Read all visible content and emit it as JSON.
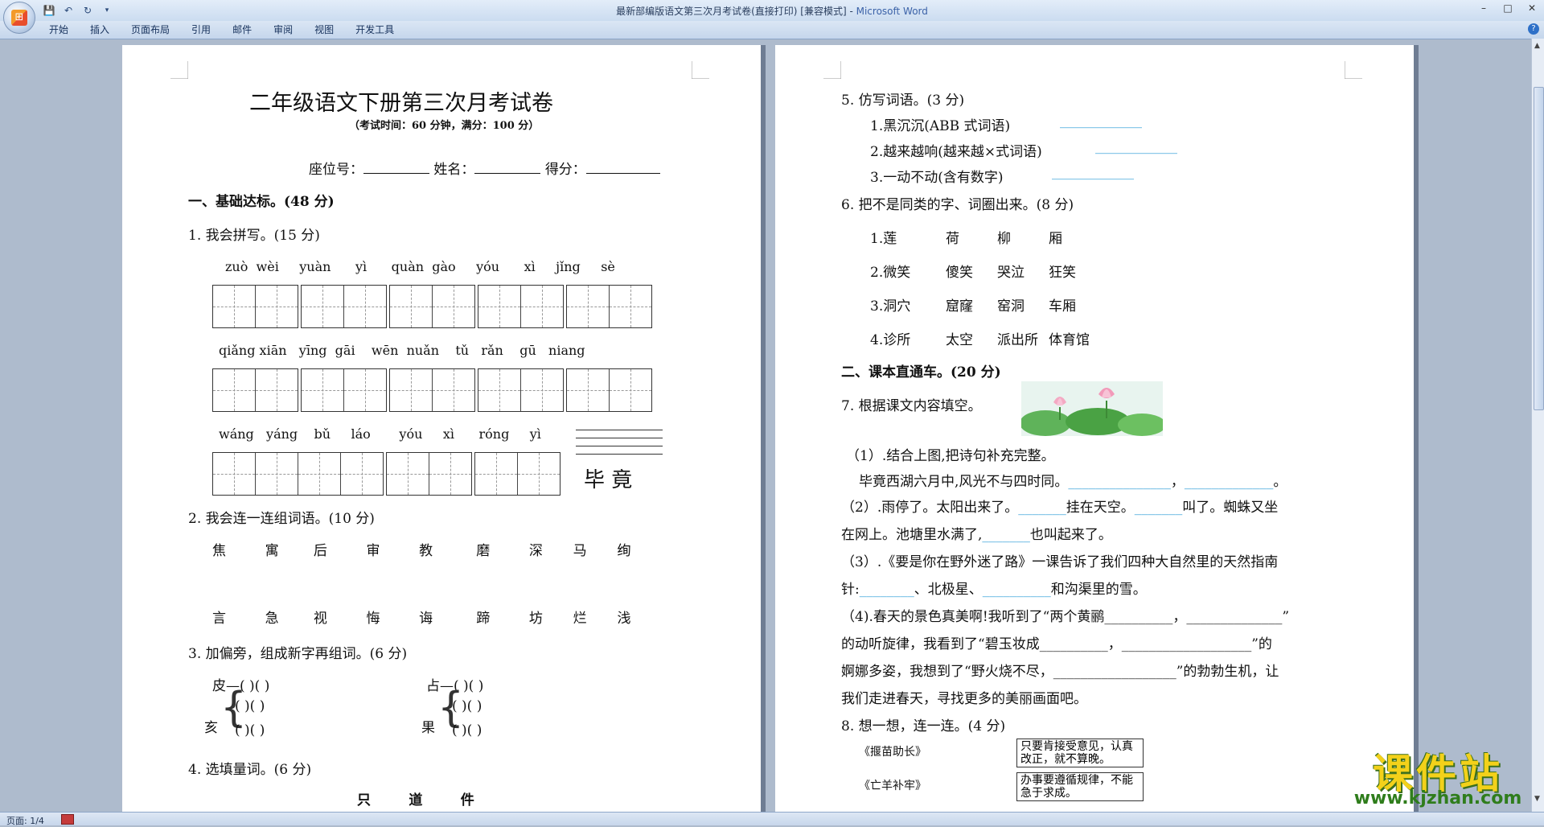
{
  "titlebar": {
    "doc_title": "最新部编版语文第三次月考试卷(直接打印) [兼容模式] - ",
    "app_name": "Microsoft Word"
  },
  "qat": {
    "save": "💾",
    "undo": "↶",
    "redo": "↻",
    "more": "▾"
  },
  "window_controls": {
    "minimize": "–",
    "maximize": "□",
    "close": "✕"
  },
  "ribbon": {
    "tabs": [
      "开始",
      "插入",
      "页面布局",
      "引用",
      "邮件",
      "审阅",
      "视图",
      "开发工具"
    ],
    "help": "?"
  },
  "statusbar": {
    "page": "页面: 1/4"
  },
  "watermark": {
    "title": "课件站",
    "url": "www.kjzhan.com"
  },
  "page1": {
    "title": "二年级语文下册第三次月考试卷",
    "subtitle": "（考试时间：60 分钟，满分：100 分）",
    "seat_label": "座位号：",
    "name_label": "姓名：",
    "score_label": "得分：",
    "section1": "一、基础达标。(48 分)",
    "q1": "1. 我会拼写。(15 分)",
    "pinyin_row1": [
      "zuò",
      "wèi",
      "yuàn",
      "yì",
      "quàn",
      "gào",
      "yóu",
      "xì",
      "jǐng",
      "sè"
    ],
    "pinyin_row2": [
      "qiǎng",
      "xiān",
      "yīng",
      "gāi",
      "wēn",
      "nuǎn",
      "tǔ",
      "rǎn",
      "gū",
      "niang"
    ],
    "pinyin_row3": [
      "wáng",
      "yáng",
      "bǔ",
      "láo",
      "yóu",
      "xì",
      "róng",
      "yì"
    ],
    "bijing": "毕  竟",
    "q2": "2. 我会连一连组词语。(10 分)",
    "match_row1": [
      "焦",
      "寓",
      "后",
      "审",
      "教",
      "磨",
      "深",
      "马",
      "绚"
    ],
    "match_row2": [
      "言",
      "急",
      "视",
      "悔",
      "诲",
      "蹄",
      "坊",
      "烂",
      "浅"
    ],
    "q3": "3. 加偏旁，组成新字再组词。(6 分)",
    "q3_a": "皮—(      )(        )",
    "q3_b": "占—(      )(        )",
    "q3_c_char": "亥",
    "q3_d_char": "果",
    "q3_paren": "(      )(      )",
    "q4": "4. 选填量词。(6 分)",
    "q4_words": [
      "只",
      "道",
      "件"
    ]
  },
  "page2": {
    "q5": "5. 仿写词语。(3 分)",
    "q5_1": "1.黑沉沉(ABB 式词语)",
    "q5_2": "2.越来越响(越来越×式词语)",
    "q5_3": "3.一动不动(含有数字)",
    "q6": "6. 把不是同类的字、词圈出来。(8 分)",
    "q6_rows": [
      [
        "1.莲",
        "荷",
        "柳",
        "厢"
      ],
      [
        "2.微笑",
        "傻笑",
        "哭泣",
        "狂笑"
      ],
      [
        "3.洞穴",
        "窟窿",
        "窑洞",
        "车厢"
      ],
      [
        "4.诊所",
        "太空",
        "派出所",
        "体育馆"
      ]
    ],
    "section2": "二、课本直通车。(20 分)",
    "q7": "7. 根据课文内容填空。",
    "q7_1": "（1）.结合上图,把诗句补充完整。",
    "q7_1b": "毕竟西湖六月中,风光不与四时同。",
    "q7_1c": "，",
    "q7_1d": "。",
    "q7_2a": "（2）.雨停了。太阳出来了。",
    "q7_2b": "挂在天空。",
    "q7_2c": "叫了。蜘蛛又坐",
    "q7_2d": "在网上。池塘里水满了,",
    "q7_2e": "也叫起来了。",
    "q7_3a": "（3）.《要是你在野外迷了路》一课告诉了我们四种大自然里的天然指南",
    "q7_3b": "针:",
    "q7_3c": "、北极星、",
    "q7_3d": "和沟渠里的雪。",
    "q7_4a": "（4).春天的景色真美啊!我听到了“两个黄鹂__________，______________”",
    "q7_4b": "的动听旋律，我看到了“碧玉妆成__________，___________________”的",
    "q7_4c": "婀娜多姿，我想到了“野火烧不尽，__________________”的勃勃生机，让",
    "q7_4d": "我们走进春天，寻找更多的美丽画面吧。",
    "q8": "8. 想一想，连一连。(4 分)",
    "q8_a": "《揠苗助长》",
    "q8_b": "《亡羊补牢》",
    "q8_box1": "只要肯接受意见，认真改正，就不算晚。",
    "q8_box2": "办事要遵循规律，不能急于求成。"
  }
}
